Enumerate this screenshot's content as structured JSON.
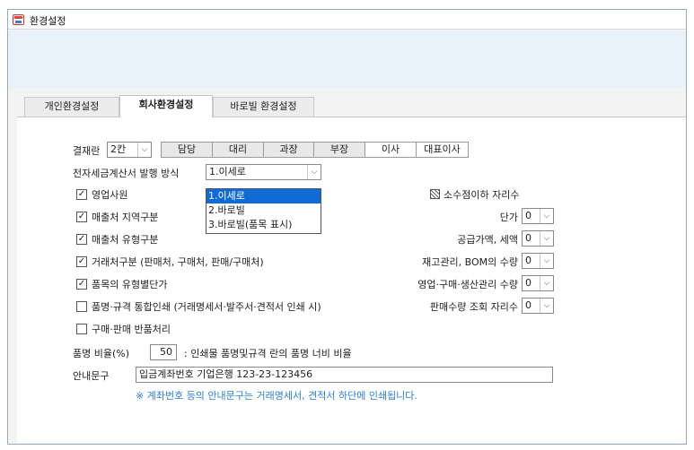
{
  "window": {
    "title": "환경설정"
  },
  "tabs": [
    "개인환경설정",
    "회사환경설정",
    "바로빌 환경설정"
  ],
  "approval": {
    "label": "결재란",
    "count_value": "2칸",
    "cells": [
      "담당",
      "대리",
      "과장",
      "부장",
      "이사",
      "대표이사"
    ]
  },
  "einvoice": {
    "label": "전자세금계산서 발행 방식",
    "value": "1.이세로",
    "options": [
      "1.이세로",
      "2.바로빌",
      "3.바로빌(품목 표시)"
    ]
  },
  "checkboxes": [
    {
      "label": "영업사원",
      "checked": true
    },
    {
      "label": "매출처 지역구분",
      "checked": true
    },
    {
      "label": "매출처 유형구분",
      "checked": true
    },
    {
      "label": "거래처구분 (판매처, 구매처, 판매/구매처)",
      "checked": true
    },
    {
      "label": "품목의 유형별단가",
      "checked": true
    },
    {
      "label": "품명·규격 통합인쇄 (거래명세서·발주서·견적서 인쇄 시)",
      "checked": false
    },
    {
      "label": "구매·판매 반품처리",
      "checked": false
    }
  ],
  "decimal": {
    "heading": "소수점이하 자리수",
    "rows": [
      {
        "label": "단가",
        "value": "0"
      },
      {
        "label": "공급가액, 세액",
        "value": "0"
      },
      {
        "label": "재고관리, BOM의 수량",
        "value": "0"
      },
      {
        "label": "영업·구매·생산관리 수량",
        "value": "0"
      },
      {
        "label": "판매수량 조회 자리수",
        "value": "0"
      }
    ]
  },
  "item_ratio": {
    "label": "품명 비율(%)",
    "value": "50",
    "desc": ": 인쇄물 품명및규격 란의 품명 너비 비율"
  },
  "notice": {
    "label": "안내문구",
    "value": "입금계좌번호 기업은행 123-23-123456",
    "note": "※ 계좌번호 등의 안내문구는 거래명세서, 견적서 하단에 인쇄됩니다."
  }
}
